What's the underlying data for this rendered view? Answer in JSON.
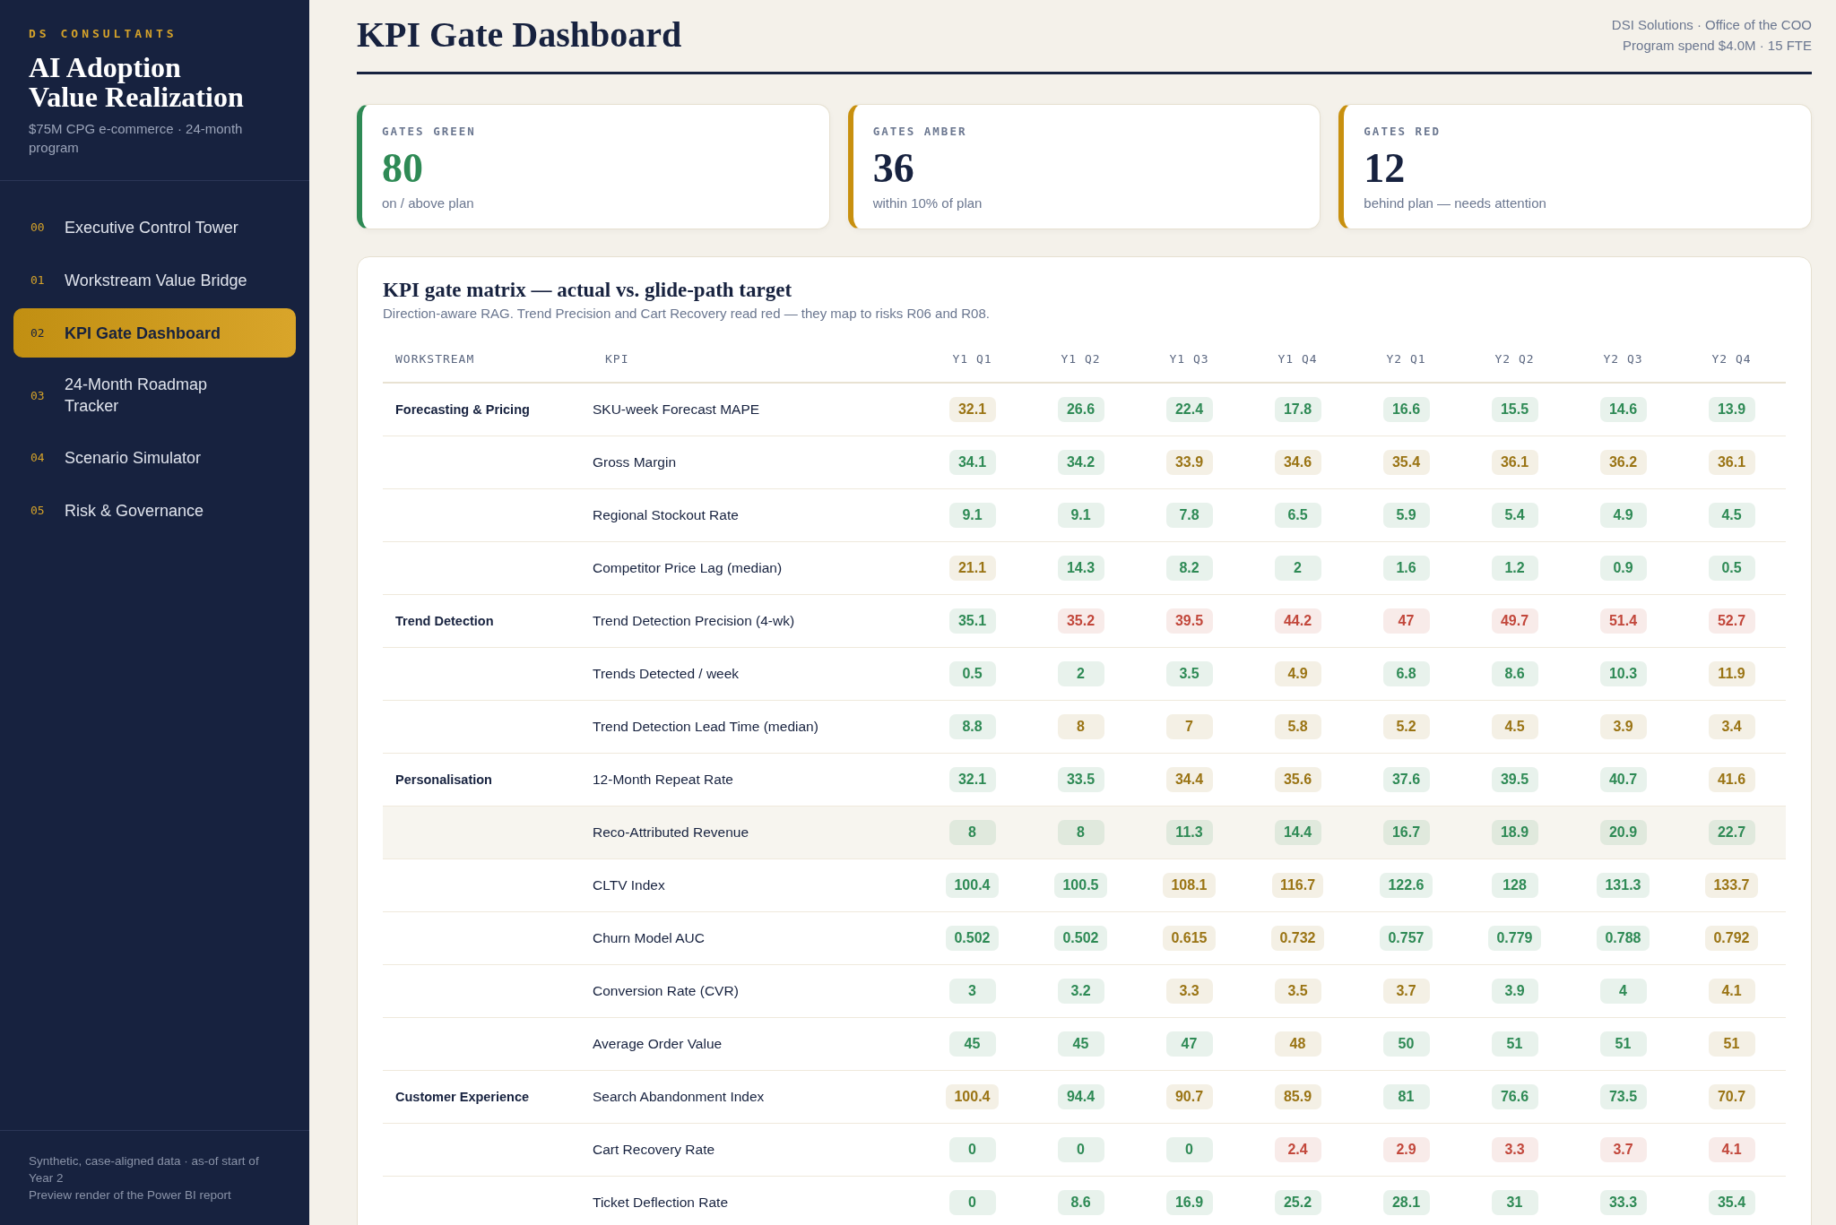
{
  "sidebar": {
    "brand": "DS CONSULTANTS",
    "title": "AI Adoption Value Realization",
    "subtitle": "$75M CPG e-commerce · 24-month program",
    "nav": [
      {
        "number": "00",
        "label": "Executive Control Tower",
        "selected": false
      },
      {
        "number": "01",
        "label": "Workstream Value Bridge",
        "selected": false
      },
      {
        "number": "02",
        "label": "KPI Gate Dashboard",
        "selected": true
      },
      {
        "number": "03",
        "label": "24-Month Roadmap Tracker",
        "selected": false
      },
      {
        "number": "04",
        "label": "Scenario Simulator",
        "selected": false
      },
      {
        "number": "05",
        "label": "Risk & Governance",
        "selected": false
      }
    ],
    "footer": [
      "Synthetic, case-aligned data · as-of start of Year 2",
      "Preview render of the Power BI report"
    ]
  },
  "header": {
    "title": "KPI Gate Dashboard",
    "meta": [
      "DSI Solutions · Office of the COO",
      "Program spend $4.0M · 15 FTE"
    ]
  },
  "cards": [
    {
      "label": "GATES GREEN",
      "value": "80",
      "note": "on / above plan",
      "color": "#2e8a55",
      "kind": "positive"
    },
    {
      "label": "GATES AMBER",
      "value": "36",
      "note": "within 10% of plan",
      "color": "#c8900f",
      "kind": "neutral"
    },
    {
      "label": "GATES RED",
      "value": "12",
      "note": "behind plan — needs attention",
      "color": "#c8900f",
      "kind": "neutral"
    }
  ],
  "matrix": {
    "title": "KPI gate matrix — actual vs. glide-path target",
    "subtitle": "Direction-aware RAG. Trend Precision and Cart Recovery read red — they map to risks R06 and R08.",
    "columns": [
      "WORKSTREAM",
      "KPI",
      "Y1 Q1",
      "Y1 Q2",
      "Y1 Q3",
      "Y1 Q4",
      "Y2 Q1",
      "Y2 Q2",
      "Y2 Q3",
      "Y2 Q4"
    ],
    "workstreams": [
      {
        "name": "Forecasting & Pricing",
        "kpis": [
          {
            "name": "SKU-week Forecast MAPE",
            "highlighted": false,
            "values": [
              {
                "value": "32.1",
                "color": "#9a7414"
              },
              {
                "value": "26.6",
                "color": "#2e8a55"
              },
              {
                "value": "22.4",
                "color": "#2e8a55"
              },
              {
                "value": "17.8",
                "color": "#2e8a55"
              },
              {
                "value": "16.6",
                "color": "#2e8a55"
              },
              {
                "value": "15.5",
                "color": "#2e8a55"
              },
              {
                "value": "14.6",
                "color": "#2e8a55"
              },
              {
                "value": "13.9",
                "color": "#2e8a55"
              }
            ]
          },
          {
            "name": "Gross Margin",
            "highlighted": false,
            "values": [
              {
                "value": "34.1",
                "color": "#2e8a55"
              },
              {
                "value": "34.2",
                "color": "#2e8a55"
              },
              {
                "value": "33.9",
                "color": "#9a7414"
              },
              {
                "value": "34.6",
                "color": "#9a7414"
              },
              {
                "value": "35.4",
                "color": "#9a7414"
              },
              {
                "value": "36.1",
                "color": "#9a7414"
              },
              {
                "value": "36.2",
                "color": "#9a7414"
              },
              {
                "value": "36.1",
                "color": "#9a7414"
              }
            ]
          },
          {
            "name": "Regional Stockout Rate",
            "highlighted": false,
            "values": [
              {
                "value": "9.1",
                "color": "#2e8a55"
              },
              {
                "value": "9.1",
                "color": "#2e8a55"
              },
              {
                "value": "7.8",
                "color": "#2e8a55"
              },
              {
                "value": "6.5",
                "color": "#2e8a55"
              },
              {
                "value": "5.9",
                "color": "#2e8a55"
              },
              {
                "value": "5.4",
                "color": "#2e8a55"
              },
              {
                "value": "4.9",
                "color": "#2e8a55"
              },
              {
                "value": "4.5",
                "color": "#2e8a55"
              }
            ]
          },
          {
            "name": "Competitor Price Lag (median)",
            "highlighted": false,
            "values": [
              {
                "value": "21.1",
                "color": "#9a7414"
              },
              {
                "value": "14.3",
                "color": "#2e8a55"
              },
              {
                "value": "8.2",
                "color": "#2e8a55"
              },
              {
                "value": "2",
                "color": "#2e8a55"
              },
              {
                "value": "1.6",
                "color": "#2e8a55"
              },
              {
                "value": "1.2",
                "color": "#2e8a55"
              },
              {
                "value": "0.9",
                "color": "#2e8a55"
              },
              {
                "value": "0.5",
                "color": "#2e8a55"
              }
            ]
          }
        ]
      },
      {
        "name": "Trend Detection",
        "kpis": [
          {
            "name": "Trend Detection Precision (4-wk)",
            "highlighted": false,
            "values": [
              {
                "value": "35.1",
                "color": "#2e8a55"
              },
              {
                "value": "35.2",
                "color": "#c2473b"
              },
              {
                "value": "39.5",
                "color": "#c2473b"
              },
              {
                "value": "44.2",
                "color": "#c2473b"
              },
              {
                "value": "47",
                "color": "#c2473b"
              },
              {
                "value": "49.7",
                "color": "#c2473b"
              },
              {
                "value": "51.4",
                "color": "#c2473b"
              },
              {
                "value": "52.7",
                "color": "#c2473b"
              }
            ]
          },
          {
            "name": "Trends Detected / week",
            "highlighted": false,
            "values": [
              {
                "value": "0.5",
                "color": "#2e8a55"
              },
              {
                "value": "2",
                "color": "#2e8a55"
              },
              {
                "value": "3.5",
                "color": "#2e8a55"
              },
              {
                "value": "4.9",
                "color": "#9a7414"
              },
              {
                "value": "6.8",
                "color": "#2e8a55"
              },
              {
                "value": "8.6",
                "color": "#2e8a55"
              },
              {
                "value": "10.3",
                "color": "#2e8a55"
              },
              {
                "value": "11.9",
                "color": "#9a7414"
              }
            ]
          },
          {
            "name": "Trend Detection Lead Time (median)",
            "highlighted": false,
            "values": [
              {
                "value": "8.8",
                "color": "#2e8a55"
              },
              {
                "value": "8",
                "color": "#9a7414"
              },
              {
                "value": "7",
                "color": "#9a7414"
              },
              {
                "value": "5.8",
                "color": "#9a7414"
              },
              {
                "value": "5.2",
                "color": "#9a7414"
              },
              {
                "value": "4.5",
                "color": "#9a7414"
              },
              {
                "value": "3.9",
                "color": "#9a7414"
              },
              {
                "value": "3.4",
                "color": "#9a7414"
              }
            ]
          }
        ]
      },
      {
        "name": "Personalisation",
        "kpis": [
          {
            "name": "12-Month Repeat Rate",
            "highlighted": false,
            "values": [
              {
                "value": "32.1",
                "color": "#2e8a55"
              },
              {
                "value": "33.5",
                "color": "#2e8a55"
              },
              {
                "value": "34.4",
                "color": "#9a7414"
              },
              {
                "value": "35.6",
                "color": "#9a7414"
              },
              {
                "value": "37.6",
                "color": "#2e8a55"
              },
              {
                "value": "39.5",
                "color": "#2e8a55"
              },
              {
                "value": "40.7",
                "color": "#2e8a55"
              },
              {
                "value": "41.6",
                "color": "#9a7414"
              }
            ]
          },
          {
            "name": "Reco-Attributed Revenue",
            "highlighted": true,
            "values": [
              {
                "value": "8",
                "color": "#2e8a55"
              },
              {
                "value": "8",
                "color": "#2e8a55"
              },
              {
                "value": "11.3",
                "color": "#2e8a55"
              },
              {
                "value": "14.4",
                "color": "#2e8a55"
              },
              {
                "value": "16.7",
                "color": "#2e8a55"
              },
              {
                "value": "18.9",
                "color": "#2e8a55"
              },
              {
                "value": "20.9",
                "color": "#2e8a55"
              },
              {
                "value": "22.7",
                "color": "#2e8a55"
              }
            ]
          },
          {
            "name": "CLTV Index",
            "highlighted": false,
            "values": [
              {
                "value": "100.4",
                "color": "#2e8a55"
              },
              {
                "value": "100.5",
                "color": "#2e8a55"
              },
              {
                "value": "108.1",
                "color": "#9a7414"
              },
              {
                "value": "116.7",
                "color": "#9a7414"
              },
              {
                "value": "122.6",
                "color": "#2e8a55"
              },
              {
                "value": "128",
                "color": "#2e8a55"
              },
              {
                "value": "131.3",
                "color": "#2e8a55"
              },
              {
                "value": "133.7",
                "color": "#9a7414"
              }
            ]
          },
          {
            "name": "Churn Model AUC",
            "highlighted": false,
            "values": [
              {
                "value": "0.502",
                "color": "#2e8a55"
              },
              {
                "value": "0.502",
                "color": "#2e8a55"
              },
              {
                "value": "0.615",
                "color": "#9a7414"
              },
              {
                "value": "0.732",
                "color": "#9a7414"
              },
              {
                "value": "0.757",
                "color": "#2e8a55"
              },
              {
                "value": "0.779",
                "color": "#2e8a55"
              },
              {
                "value": "0.788",
                "color": "#2e8a55"
              },
              {
                "value": "0.792",
                "color": "#9a7414"
              }
            ]
          },
          {
            "name": "Conversion Rate (CVR)",
            "highlighted": false,
            "values": [
              {
                "value": "3",
                "color": "#2e8a55"
              },
              {
                "value": "3.2",
                "color": "#2e8a55"
              },
              {
                "value": "3.3",
                "color": "#9a7414"
              },
              {
                "value": "3.5",
                "color": "#9a7414"
              },
              {
                "value": "3.7",
                "color": "#9a7414"
              },
              {
                "value": "3.9",
                "color": "#2e8a55"
              },
              {
                "value": "4",
                "color": "#2e8a55"
              },
              {
                "value": "4.1",
                "color": "#9a7414"
              }
            ]
          },
          {
            "name": "Average Order Value",
            "highlighted": false,
            "values": [
              {
                "value": "45",
                "color": "#2e8a55"
              },
              {
                "value": "45",
                "color": "#2e8a55"
              },
              {
                "value": "47",
                "color": "#2e8a55"
              },
              {
                "value": "48",
                "color": "#9a7414"
              },
              {
                "value": "50",
                "color": "#2e8a55"
              },
              {
                "value": "51",
                "color": "#2e8a55"
              },
              {
                "value": "51",
                "color": "#2e8a55"
              },
              {
                "value": "51",
                "color": "#9a7414"
              }
            ]
          }
        ]
      },
      {
        "name": "Customer Experience",
        "kpis": [
          {
            "name": "Search Abandonment Index",
            "highlighted": false,
            "values": [
              {
                "value": "100.4",
                "color": "#9a7414"
              },
              {
                "value": "94.4",
                "color": "#2e8a55"
              },
              {
                "value": "90.7",
                "color": "#9a7414"
              },
              {
                "value": "85.9",
                "color": "#9a7414"
              },
              {
                "value": "81",
                "color": "#2e8a55"
              },
              {
                "value": "76.6",
                "color": "#2e8a55"
              },
              {
                "value": "73.5",
                "color": "#2e8a55"
              },
              {
                "value": "70.7",
                "color": "#9a7414"
              }
            ]
          },
          {
            "name": "Cart Recovery Rate",
            "highlighted": false,
            "values": [
              {
                "value": "0",
                "color": "#2e8a55"
              },
              {
                "value": "0",
                "color": "#2e8a55"
              },
              {
                "value": "0",
                "color": "#2e8a55"
              },
              {
                "value": "2.4",
                "color": "#c2473b"
              },
              {
                "value": "2.9",
                "color": "#c2473b"
              },
              {
                "value": "3.3",
                "color": "#c2473b"
              },
              {
                "value": "3.7",
                "color": "#c2473b"
              },
              {
                "value": "4.1",
                "color": "#c2473b"
              }
            ]
          },
          {
            "name": "Ticket Deflection Rate",
            "highlighted": false,
            "values": [
              {
                "value": "0",
                "color": "#2e8a55"
              },
              {
                "value": "8.6",
                "color": "#2e8a55"
              },
              {
                "value": "16.9",
                "color": "#2e8a55"
              },
              {
                "value": "25.2",
                "color": "#2e8a55"
              },
              {
                "value": "28.1",
                "color": "#2e8a55"
              },
              {
                "value": "31",
                "color": "#2e8a55"
              },
              {
                "value": "33.3",
                "color": "#2e8a55"
              },
              {
                "value": "35.4",
                "color": "#2e8a55"
              }
            ]
          }
        ]
      }
    ]
  }
}
